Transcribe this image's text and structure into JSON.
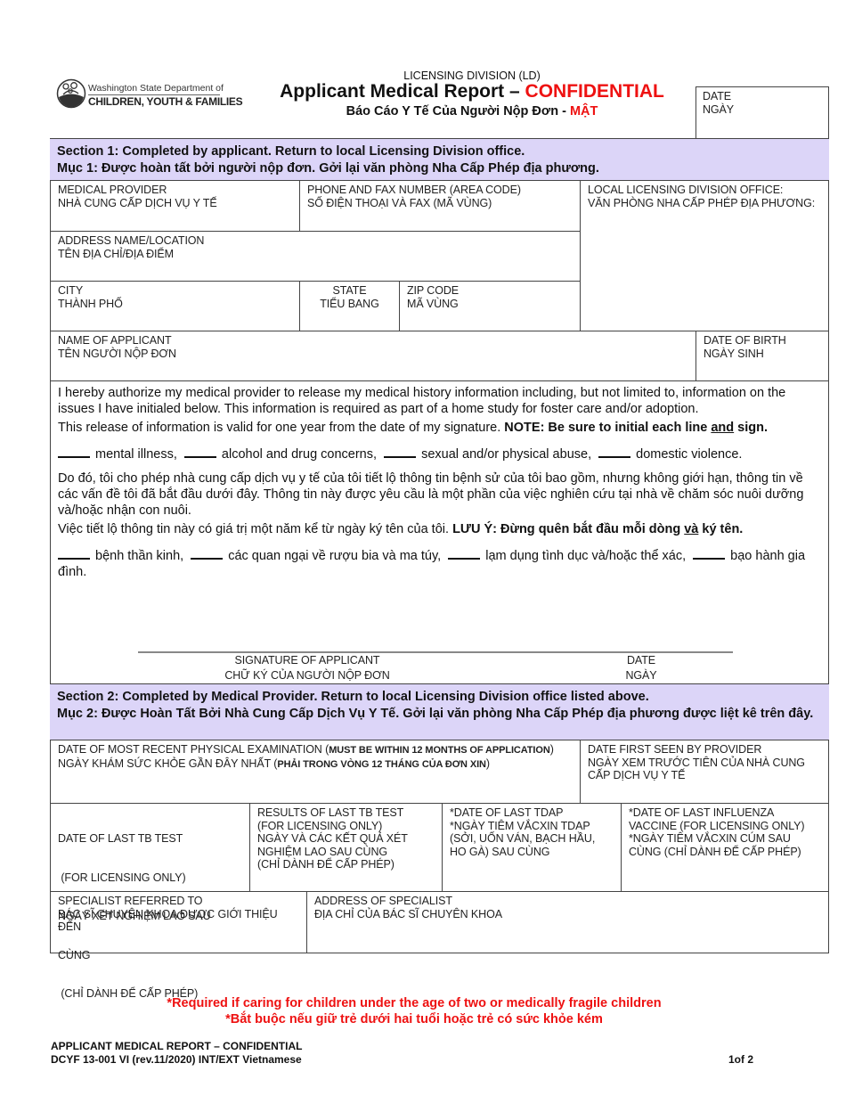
{
  "header": {
    "logo": {
      "line1": "Washington State Department of",
      "line2": "CHILDREN, YOUTH & FAMILIES"
    },
    "division": "LICENSING DIVISION (LD)",
    "title_main": "Applicant Medical Report – ",
    "title_confidential": "CONFIDENTIAL",
    "subtitle_main": "Báo Cáo Y Tế Của Người Nộp Đơn - ",
    "subtitle_confidential": "MẬT",
    "date_box": {
      "label_en": "DATE",
      "label_vi": "NGÀY",
      "value": ""
    }
  },
  "section1": {
    "heading_en": "Section 1:  Completed by applicant. Return to local Licensing Division office.",
    "heading_vi": "Mục 1:  Được hoàn tất bởi người nộp đơn. Gởi lại văn phòng Nha Cấp Phép địa phương.",
    "fields": {
      "medical_provider": {
        "en": "MEDICAL PROVIDER",
        "vi": "NHÀ CUNG CẤP DỊCH VỤ Y TẾ",
        "value": ""
      },
      "phone_fax": {
        "en": "PHONE AND FAX NUMBER (AREA CODE)",
        "vi": "SỐ ĐIỆN THOẠI VÀ FAX (MÃ VÙNG)",
        "value": ""
      },
      "local_office": {
        "en": "LOCAL LICENSING DIVISION OFFICE:",
        "vi": "VĂN PHÒNG NHA CẤP PHÉP ĐỊA PHƯƠNG:",
        "value": ""
      },
      "address": {
        "en": "ADDRESS NAME/LOCATION",
        "vi": "TÊN ĐỊA CHỈ/ĐỊA ĐIỂM",
        "value": ""
      },
      "city": {
        "en": "CITY",
        "vi": "THÀNH PHỐ",
        "value": ""
      },
      "state": {
        "en": "STATE",
        "vi": "TIỂU BANG",
        "value": ""
      },
      "zip": {
        "en": "ZIP CODE",
        "vi": "MÃ VÙNG",
        "value": ""
      },
      "applicant_name": {
        "en": "NAME OF APPLICANT",
        "vi": "TÊN NGƯỜI NỘP ĐƠN",
        "value": ""
      },
      "dob": {
        "en": "DATE OF BIRTH",
        "vi": "NGÀY SINH",
        "value": ""
      }
    },
    "authorization": {
      "en_p1": "I hereby authorize my medical provider to release my medical history information including, but not limited to, information on the issues I have initialed below.  This information is required as part of a home study for foster care and/or adoption.",
      "en_p2_plain": "This release of information is valid for one year from the date of my signature.  ",
      "en_p2_bold_a": "NOTE:  Be sure to initial each line ",
      "en_p2_bold_u": "and",
      "en_p2_bold_b": " sign.",
      "en_initials": [
        "mental illness,",
        "alcohol and drug concerns,",
        "sexual and/or physical abuse,",
        "domestic violence."
      ],
      "vi_p1": "Do đó, tôi cho phép nhà cung cấp dịch vụ y tế của tôi tiết lộ thông tin bệnh sử của tôi bao gồm, nhưng không giới hạn, thông tin về các vấn đề tôi đã bắt đầu dưới đây.  Thông tin này được yêu cầu là một phần của việc nghiên cứu tại nhà về chăm sóc nuôi dưỡng và/hoặc nhận con nuôi.",
      "vi_p2_plain": "Việc tiết lộ thông tin này có giá trị một năm kể từ ngày ký tên của tôi.  ",
      "vi_p2_bold_a": "LƯU Ý:  Đừng quên bắt đầu mỗi dòng ",
      "vi_p2_bold_u": "và",
      "vi_p2_bold_b": " ký tên.",
      "vi_initials": [
        "bệnh thần kinh,",
        "các quan ngại về rượu bia và ma túy,",
        "lạm dụng tình dục và/hoặc thể xác,",
        "bạo hành gia đình."
      ]
    },
    "signature": {
      "label_en": "SIGNATURE OF APPLICANT",
      "label_vi": "CHỮ KÝ CỦA NGƯỜI NỘP ĐƠN",
      "date_en": "DATE",
      "date_vi": "NGÀY"
    }
  },
  "section2": {
    "heading_en": "Section 2:  Completed by Medical Provider.  Return to local Licensing Division office listed above.",
    "heading_vi": "Mục 2:  Được Hoàn Tất Bởi Nhà Cung Cấp Dịch Vụ Y Tế.  Gởi lại văn phòng Nha Cấp Phép địa phương được liệt kê trên đây.",
    "fields": {
      "physical_exam": {
        "en": "DATE OF MOST RECENT PHYSICAL EXAMINATION (",
        "en_bold": "MUST BE WITHIN 12 MONTHS OF APPLICATION",
        "en_end": ")",
        "vi": "NGÀY KHÁM SỨC KHỎE GẦN ĐÂY NHẤT (",
        "vi_bold": "PHẢI TRONG VÒNG 12 THÁNG CỦA ĐƠN XIN",
        "vi_end": ")",
        "value": ""
      },
      "first_seen": {
        "lines": [
          "DATE FIRST SEEN BY PROVIDER",
          "NGÀY XEM TRƯỚC TIÊN CỦA NHÀ CUNG",
          "CẤP DỊCH VỤ Y TẾ"
        ],
        "value": ""
      },
      "tb_date": {
        "lines": [
          "DATE OF LAST TB TEST",
          " (FOR LICENSING ONLY)",
          "NGÀY XÉT NGHIỆM LAO SAU",
          "CÙNG",
          " (CHỈ DÀNH ĐỂ CẤP PHÉP)"
        ],
        "value": ""
      },
      "tb_results": {
        "lines": [
          "RESULTS OF LAST TB TEST",
          "(FOR LICENSING ONLY)",
          "NGÀY VÀ CÁC KẾT QUẢ XÉT",
          "NGHIỆM LAO SAU CÙNG",
          "(CHỈ DÀNH ĐỂ CẤP PHÉP)"
        ],
        "value": ""
      },
      "tdap": {
        "lines": [
          "*DATE OF LAST TDAP",
          "*NGÀY TIÊM VẮCXIN TDAP",
          "(SỞI, UỐN VÁN, BẠCH HẦU,",
          "HO GÀ) SAU CÙNG"
        ],
        "value": ""
      },
      "influenza": {
        "lines": [
          "*DATE OF LAST INFLUENZA",
          "VACCINE (FOR LICENSING ONLY)",
          "*NGÀY TIÊM VẮCXIN CÚM SAU",
          "CÙNG (CHỈ DÀNH ĐỂ CẤP PHÉP)"
        ],
        "value": ""
      },
      "specialist": {
        "lines": [
          "SPECIALIST REFERRED TO",
          "BÁC SĨ CHUYÊN KHOA ĐƯỢC GIỚI THIỆU",
          "ĐẾN"
        ],
        "value": ""
      },
      "specialist_address": {
        "lines": [
          "ADDRESS OF SPECIALIST",
          "ĐỊA CHỈ CỦA BÁC SĨ CHUYÊN KHOA"
        ],
        "value": ""
      }
    }
  },
  "notes": {
    "required_en": "*Required if caring for children under the age of two or medically fragile children",
    "required_vi": "*Bắt buộc nếu giữ trẻ dưới hai tuổi hoặc trẻ có sức khỏe kém"
  },
  "footer": {
    "line1": "APPLICANT MEDICAL REPORT – CONFIDENTIAL",
    "line2": "DCYF 13-001 VI (rev.11/2020) INT/EXT Vietnamese",
    "page": "1of 2"
  },
  "colors": {
    "section_header_bg": "#dcd5f8",
    "confidential_red": "#ee1111",
    "border": "#444444"
  }
}
